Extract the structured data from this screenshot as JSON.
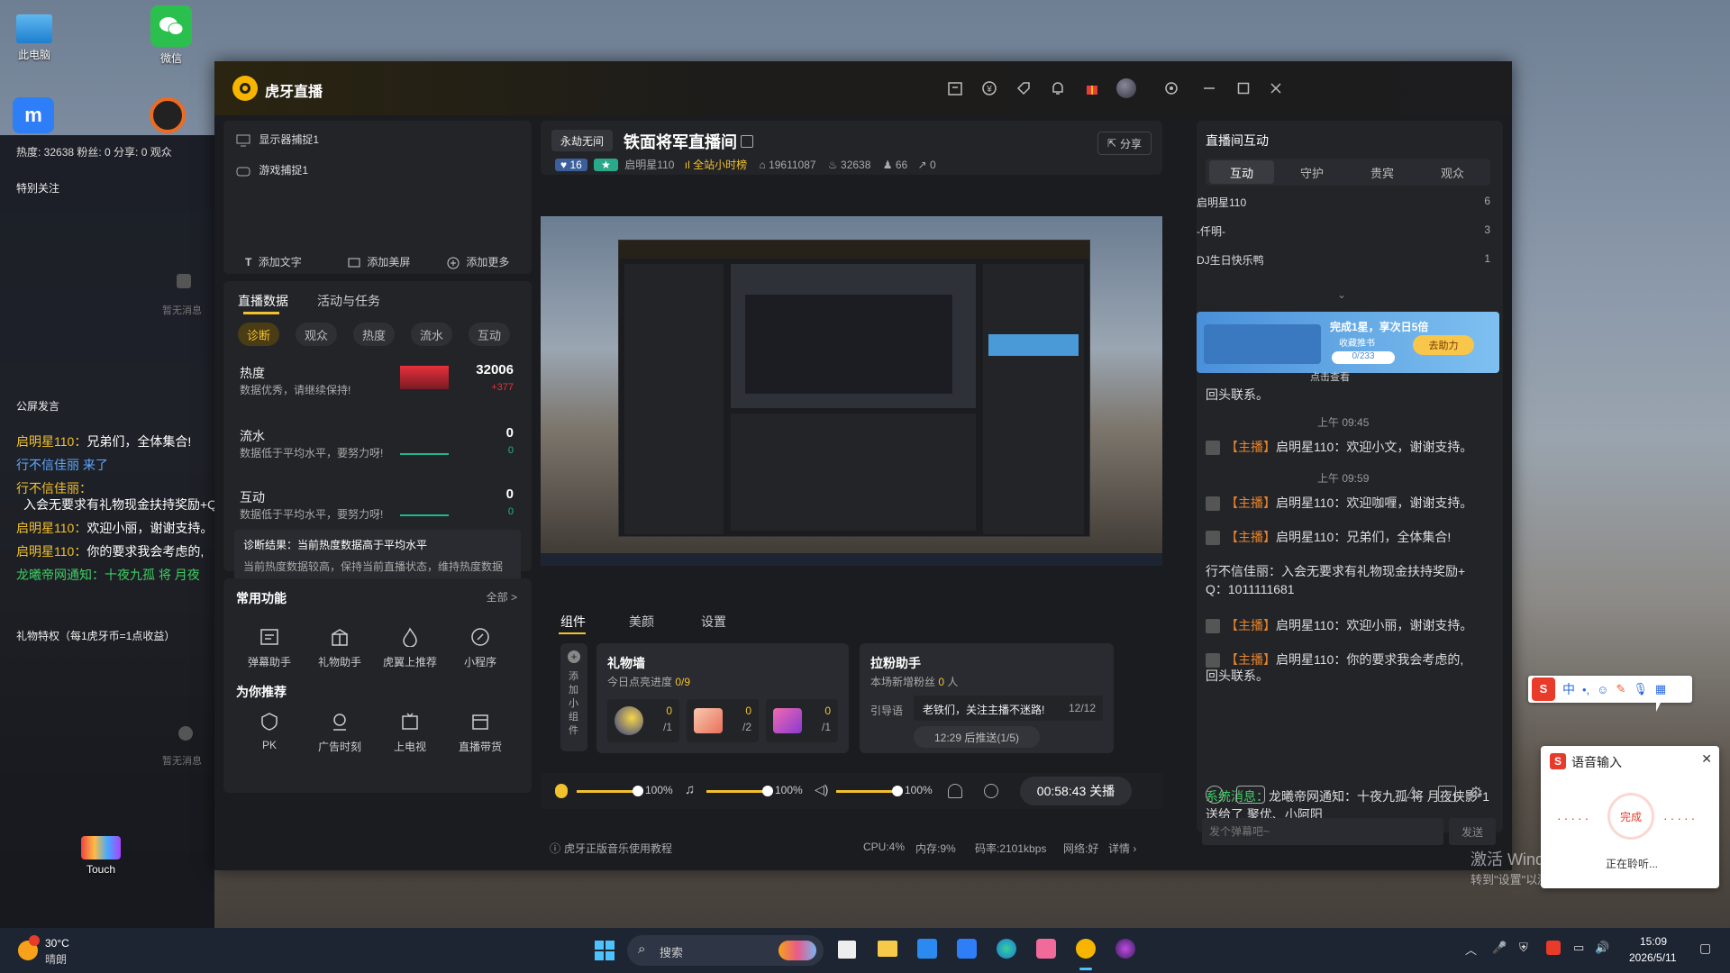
{
  "desktop": {
    "icons": [
      {
        "label": "此电脑",
        "icon": "computer-icon"
      },
      {
        "label": "微信",
        "icon": "wechat-icon"
      },
      {
        "label": "Touch",
        "icon": "touch-icon"
      }
    ],
    "watermark_line1": "激活 Windows",
    "watermark_line2": "转到\"设置\"以激活 Windows。"
  },
  "left_panel": {
    "stats": "热度: 32638   粉丝: 0   分享: 0   观众",
    "special_follow": "特别关注",
    "no_message": "暂无消息",
    "public_screen": "公屏发言",
    "chat": [
      {
        "user": "启明星110：",
        "text": "兄弟们，全体集合!",
        "user_color": "#f2c12e",
        "text_color": "#ffffff"
      },
      {
        "user": "行不信佳丽",
        "text": " 来了",
        "user_color": "#5fa8ff",
        "text_color": "#5fa8ff"
      },
      {
        "user": "行不信佳丽：",
        "text": "",
        "user_color": "#f2c12e",
        "text_color": "#ffffff"
      },
      {
        "user": "",
        "text": "入会无要求有礼物现金扶持奖励+Q",
        "user_color": "#f2c12e",
        "text_color": "#ffffff"
      },
      {
        "user": "启明星110：",
        "text": "欢迎小丽，谢谢支持。",
        "user_color": "#f2c12e",
        "text_color": "#ffffff"
      },
      {
        "user": "启明星110：",
        "text": "你的要求我会考虑的,",
        "user_color": "#f2c12e",
        "text_color": "#ffffff"
      },
      {
        "user": "龙曦帝网通知：",
        "text": "十夜九孤 将 月夜",
        "user_color": "#3ecf62",
        "text_color": "#3ecf62"
      }
    ],
    "gift_privilege": "礼物特权（每1虎牙币=1点收益）",
    "no_message2": "暂无消息"
  },
  "window": {
    "app_name": "虎牙直播",
    "sources": [
      "显示器捕捉1",
      "游戏捕捉1"
    ],
    "add_text": "添加文字",
    "add_beauty": "添加美屏",
    "add_more": "添加更多",
    "data_tabs": [
      "直播数据",
      "活动与任务"
    ],
    "filter_pills": [
      "诊断",
      "观众",
      "热度",
      "流水",
      "互动"
    ],
    "metrics": [
      {
        "title": "热度",
        "sub": "数据优秀，请继续保持!",
        "value": "32006",
        "delta": "+377"
      },
      {
        "title": "流水",
        "sub": "数据低于平均水平，要努力呀!",
        "value": "0",
        "delta": "0"
      },
      {
        "title": "互动",
        "sub": "数据低于平均水平，要努力呀!",
        "value": "0",
        "delta": "0"
      }
    ],
    "diagnosis_title": "诊断结果：当前热度数据高于平均水平",
    "diagnosis_body": "当前热度数据较高，保持当前直播状态，维持热度数据",
    "common_functions": "常用功能",
    "all_label": "全部",
    "functions": [
      "弹幕助手",
      "礼物助手",
      "虎翼上推荐",
      "小程序"
    ],
    "for_you": "为你推荐",
    "recommends": [
      "PK",
      "广告时刻",
      "上电视",
      "直播带货"
    ],
    "room": {
      "category": "永劫无间",
      "title": "铁面将军直播间",
      "share": "分享",
      "level": "16",
      "streamer": "启明星110",
      "rank": "全站小时榜",
      "room_id": "19611087",
      "heat": "32638",
      "viewers": "66",
      "shares": "0"
    },
    "bottom_tabs": [
      "组件",
      "美颜",
      "设置"
    ],
    "add_widget": "添加小组件",
    "gift_wall": {
      "title": "礼物墙",
      "progress_label": "今日点亮进度",
      "progress": "0/9",
      "gifts": [
        {
          "count": "0",
          "total": "/1"
        },
        {
          "count": "0",
          "total": "/2"
        },
        {
          "count": "0",
          "total": "/1"
        }
      ]
    },
    "fan_helper": {
      "title": "拉粉助手",
      "sub_label": "本场新增粉丝",
      "count": "0",
      "unit": "人",
      "guide_label": "引导语",
      "guide_text": "老铁们，关注主播不迷路!",
      "guide_count": "12/12",
      "push_btn": "12:29 后推送(1/5)"
    },
    "audio": {
      "mic": "100%",
      "music": "100%",
      "speaker": "100%",
      "mic_level": 1.0,
      "music_level": 1.0,
      "speaker_level": 1.0
    },
    "end_stream": "00:58:43 关播",
    "status": {
      "tip": "虎牙正版音乐使用教程",
      "cpu": "CPU:4%",
      "mem": "内存:9%",
      "bitrate": "码率:2101kbps",
      "network": "网络:好",
      "details": "详情"
    },
    "interaction": {
      "title": "直播间互动",
      "tabs": [
        "互动",
        "守护",
        "贵宾",
        "观众"
      ],
      "ranking": [
        {
          "name": "启明星110",
          "count": "6"
        },
        {
          "name": "-仟明-",
          "count": "3"
        },
        {
          "name": "DJ生日快乐鸭",
          "count": "1"
        }
      ],
      "banner_task": "完成1星，享次日5倍",
      "banner_sub": "收藏推书",
      "banner_progress": "0/233",
      "banner_btn": "去助力",
      "banner_view": "点击查看",
      "reply_tail": "回头联系。",
      "messages": [
        {
          "type": "time",
          "text": "上午 09:45"
        },
        {
          "type": "host",
          "tag": "【主播】",
          "user": "启明星110：",
          "text": "欢迎小文，谢谢支持。"
        },
        {
          "type": "time",
          "text": "上午 09:59"
        },
        {
          "type": "host",
          "tag": "【主播】",
          "user": "启明星110：",
          "text": "欢迎咖喱，谢谢支持。"
        },
        {
          "type": "host",
          "tag": "【主播】",
          "user": "启明星110：",
          "text": "兄弟们，全体集合!"
        },
        {
          "type": "plain",
          "text": "行不信佳丽：入会无要求有礼物现金扶持奖励+"
        },
        {
          "type": "plain",
          "text": "Q：1011111681"
        },
        {
          "type": "host",
          "tag": "【主播】",
          "user": "启明星110：",
          "text": "欢迎小丽，谢谢支持。"
        },
        {
          "type": "host",
          "tag": "【主播】",
          "user": "启明星110：",
          "text": "你的要求我会考虑的,"
        },
        {
          "type": "plain",
          "text": "回头联系。"
        }
      ],
      "system_label": "系统消息：",
      "system_text": "龙曦帝网通知：十夜九孤 将 月夜侠影*1",
      "system_text2": "送给了 聚优、小阿阳",
      "input_placeholder": "发个弹幕吧~",
      "send": "发送"
    }
  },
  "voice_input": {
    "title": "语音输入",
    "done": "完成",
    "listening": "正在聆听..."
  },
  "ime": {
    "label": "中"
  },
  "taskbar": {
    "weather_temp": "30°C",
    "weather_desc": "晴朗",
    "search_placeholder": "搜索",
    "time": "15:09",
    "date": "2026/5/11"
  }
}
